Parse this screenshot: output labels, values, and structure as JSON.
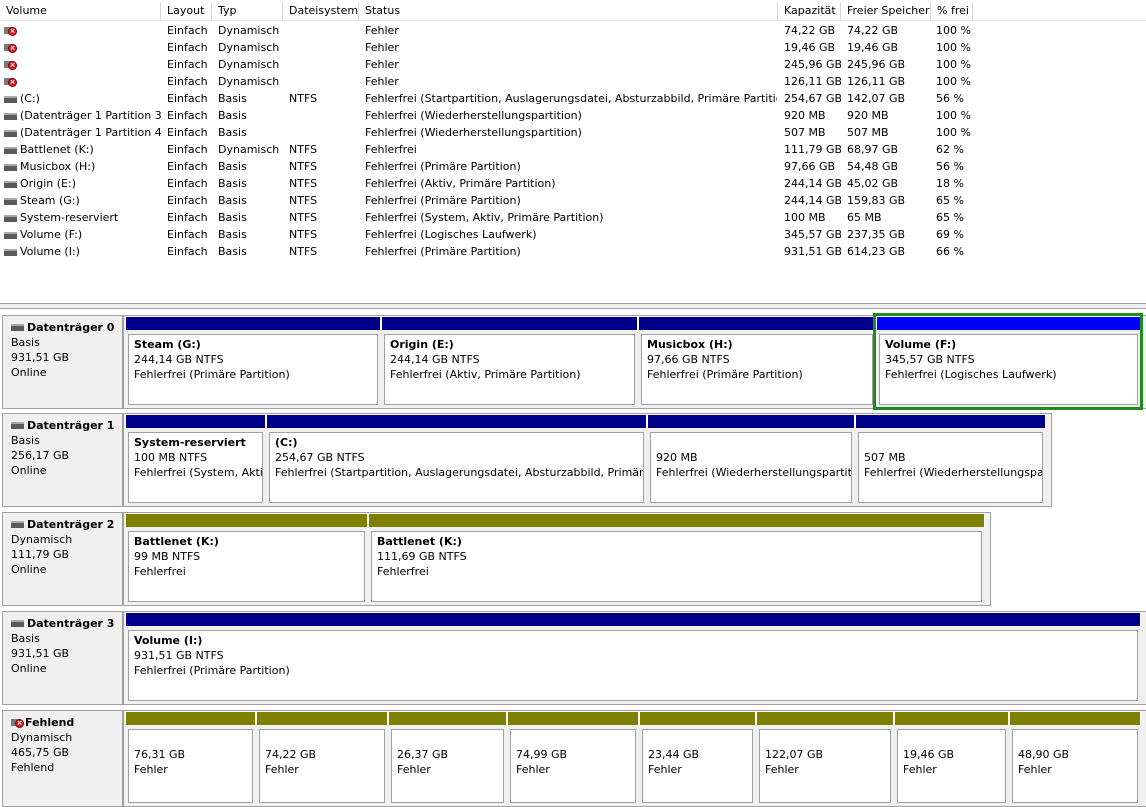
{
  "columns": {
    "volume": "Volume",
    "layout": "Layout",
    "typ": "Typ",
    "fs": "Dateisystem",
    "status": "Status",
    "cap": "Kapazität",
    "free": "Freier Speicher",
    "pct": "% frei"
  },
  "volumes": [
    {
      "icon": "error",
      "name": "",
      "layout": "Einfach",
      "typ": "Dynamisch",
      "fs": "",
      "status": "Fehler",
      "cap": "74,22 GB",
      "free": "74,22 GB",
      "pct": "100 %"
    },
    {
      "icon": "error",
      "name": "",
      "layout": "Einfach",
      "typ": "Dynamisch",
      "fs": "",
      "status": "Fehler",
      "cap": "19,46 GB",
      "free": "19,46 GB",
      "pct": "100 %"
    },
    {
      "icon": "error",
      "name": "",
      "layout": "Einfach",
      "typ": "Dynamisch",
      "fs": "",
      "status": "Fehler",
      "cap": "245,96 GB",
      "free": "245,96 GB",
      "pct": "100 %"
    },
    {
      "icon": "error",
      "name": "",
      "layout": "Einfach",
      "typ": "Dynamisch",
      "fs": "",
      "status": "Fehler",
      "cap": "126,11 GB",
      "free": "126,11 GB",
      "pct": "100 %"
    },
    {
      "icon": "drive",
      "name": "(C:)",
      "layout": "Einfach",
      "typ": "Basis",
      "fs": "NTFS",
      "status": "Fehlerfrei (Startpartition, Auslagerungsdatei, Absturzabbild, Primäre Partition)",
      "cap": "254,67 GB",
      "free": "142,07 GB",
      "pct": "56 %"
    },
    {
      "icon": "drive",
      "name": "(Datenträger 1 Partition 3)",
      "layout": "Einfach",
      "typ": "Basis",
      "fs": "",
      "status": "Fehlerfrei (Wiederherstellungspartition)",
      "cap": "920 MB",
      "free": "920 MB",
      "pct": "100 %"
    },
    {
      "icon": "drive",
      "name": "(Datenträger 1 Partition 4)",
      "layout": "Einfach",
      "typ": "Basis",
      "fs": "",
      "status": "Fehlerfrei (Wiederherstellungspartition)",
      "cap": "507 MB",
      "free": "507 MB",
      "pct": "100 %"
    },
    {
      "icon": "drive",
      "name": "Battlenet (K:)",
      "layout": "Einfach",
      "typ": "Dynamisch",
      "fs": "NTFS",
      "status": "Fehlerfrei",
      "cap": "111,79 GB",
      "free": "68,97 GB",
      "pct": "62 %"
    },
    {
      "icon": "drive",
      "name": "Musicbox (H:)",
      "layout": "Einfach",
      "typ": "Basis",
      "fs": "NTFS",
      "status": "Fehlerfrei (Primäre Partition)",
      "cap": "97,66 GB",
      "free": "54,48 GB",
      "pct": "56 %"
    },
    {
      "icon": "drive",
      "name": "Origin (E:)",
      "layout": "Einfach",
      "typ": "Basis",
      "fs": "NTFS",
      "status": "Fehlerfrei (Aktiv, Primäre Partition)",
      "cap": "244,14 GB",
      "free": "45,02 GB",
      "pct": "18 %"
    },
    {
      "icon": "drive",
      "name": "Steam (G:)",
      "layout": "Einfach",
      "typ": "Basis",
      "fs": "NTFS",
      "status": "Fehlerfrei (Primäre Partition)",
      "cap": "244,14 GB",
      "free": "159,83 GB",
      "pct": "65 %"
    },
    {
      "icon": "drive",
      "name": "System-reserviert",
      "layout": "Einfach",
      "typ": "Basis",
      "fs": "NTFS",
      "status": "Fehlerfrei (System, Aktiv, Primäre Partition)",
      "cap": "100 MB",
      "free": "65 MB",
      "pct": "65 %"
    },
    {
      "icon": "drive",
      "name": "Volume (F:)",
      "layout": "Einfach",
      "typ": "Basis",
      "fs": "NTFS",
      "status": "Fehlerfrei (Logisches Laufwerk)",
      "cap": "345,57 GB",
      "free": "237,35 GB",
      "pct": "69 %"
    },
    {
      "icon": "drive",
      "name": "Volume (I:)",
      "layout": "Einfach",
      "typ": "Basis",
      "fs": "NTFS",
      "status": "Fehlerfrei (Primäre Partition)",
      "cap": "931,51 GB",
      "free": "614,23 GB",
      "pct": "66 %"
    }
  ],
  "colors": {
    "basic": "#00008b",
    "dynamic": "#808000",
    "logical": "#0000ff",
    "selection": "#1e8c1e"
  },
  "disks": [
    {
      "icon": "drive",
      "name": "Datenträger 0",
      "type": "Basis",
      "size": "931,51 GB",
      "state": "Online",
      "partitions": [
        {
          "title": "Steam  (G:)",
          "line2": "244,14 GB NTFS",
          "line3": "Fehlerfrei (Primäre Partition)",
          "bar": "basic"
        },
        {
          "title": "Origin  (E:)",
          "line2": "244,14 GB NTFS",
          "line3": "Fehlerfrei (Aktiv, Primäre Partition)",
          "bar": "basic"
        },
        {
          "title": "Musicbox  (H:)",
          "line2": "97,66 GB NTFS",
          "line3": "Fehlerfrei (Primäre Partition)",
          "bar": "basic"
        },
        {
          "title": "Volume  (F:)",
          "line2": "345,57 GB NTFS",
          "line3": "Fehlerfrei (Logisches Laufwerk)",
          "bar": "logical",
          "selected": true
        }
      ]
    },
    {
      "icon": "drive",
      "name": "Datenträger 1",
      "type": "Basis",
      "size": "256,17 GB",
      "state": "Online",
      "partitions": [
        {
          "title": "System-reserviert",
          "line2": "100 MB NTFS",
          "line3": "Fehlerfrei (System, Aktiv",
          "bar": "basic"
        },
        {
          "title": "(C:)",
          "line2": "254,67 GB NTFS",
          "line3": "Fehlerfrei (Startpartition, Auslagerungsdatei, Absturzabbild, Primäre P",
          "bar": "basic"
        },
        {
          "title": "",
          "line2": "920 MB",
          "line3": "Fehlerfrei (Wiederherstellungspartiti",
          "bar": "basic"
        },
        {
          "title": "",
          "line2": "507 MB",
          "line3": "Fehlerfrei (Wiederherstellungspart",
          "bar": "basic"
        }
      ]
    },
    {
      "icon": "drive",
      "name": "Datenträger 2",
      "type": "Dynamisch",
      "size": "111,79 GB",
      "state": "Online",
      "partitions": [
        {
          "title": "Battlenet  (K:)",
          "line2": "99 MB NTFS",
          "line3": "Fehlerfrei",
          "bar": "dynamic"
        },
        {
          "title": "Battlenet  (K:)",
          "line2": "111,69 GB NTFS",
          "line3": "Fehlerfrei",
          "bar": "dynamic"
        }
      ]
    },
    {
      "icon": "drive",
      "name": "Datenträger 3",
      "type": "Basis",
      "size": "931,51 GB",
      "state": "Online",
      "partitions": [
        {
          "title": "Volume  (I:)",
          "line2": "931,51 GB NTFS",
          "line3": "Fehlerfrei (Primäre Partition)",
          "bar": "basic"
        }
      ]
    },
    {
      "icon": "error",
      "name": "Fehlend",
      "type": "Dynamisch",
      "size": "465,75 GB",
      "state": "Fehlend",
      "partitions": [
        {
          "title": "",
          "line2": "76,31 GB",
          "line3": "Fehler",
          "bar": "dynamic"
        },
        {
          "title": "",
          "line2": "74,22 GB",
          "line3": "Fehler",
          "bar": "dynamic"
        },
        {
          "title": "",
          "line2": "26,37 GB",
          "line3": "Fehler",
          "bar": "dynamic"
        },
        {
          "title": "",
          "line2": "74,99 GB",
          "line3": "Fehler",
          "bar": "dynamic"
        },
        {
          "title": "",
          "line2": "23,44 GB",
          "line3": "Fehler",
          "bar": "dynamic"
        },
        {
          "title": "",
          "line2": "122,07 GB",
          "line3": "Fehler",
          "bar": "dynamic"
        },
        {
          "title": "",
          "line2": "19,46 GB",
          "line3": "Fehler",
          "bar": "dynamic"
        },
        {
          "title": "",
          "line2": "48,90 GB",
          "line3": "Fehler",
          "bar": "dynamic"
        }
      ]
    }
  ]
}
